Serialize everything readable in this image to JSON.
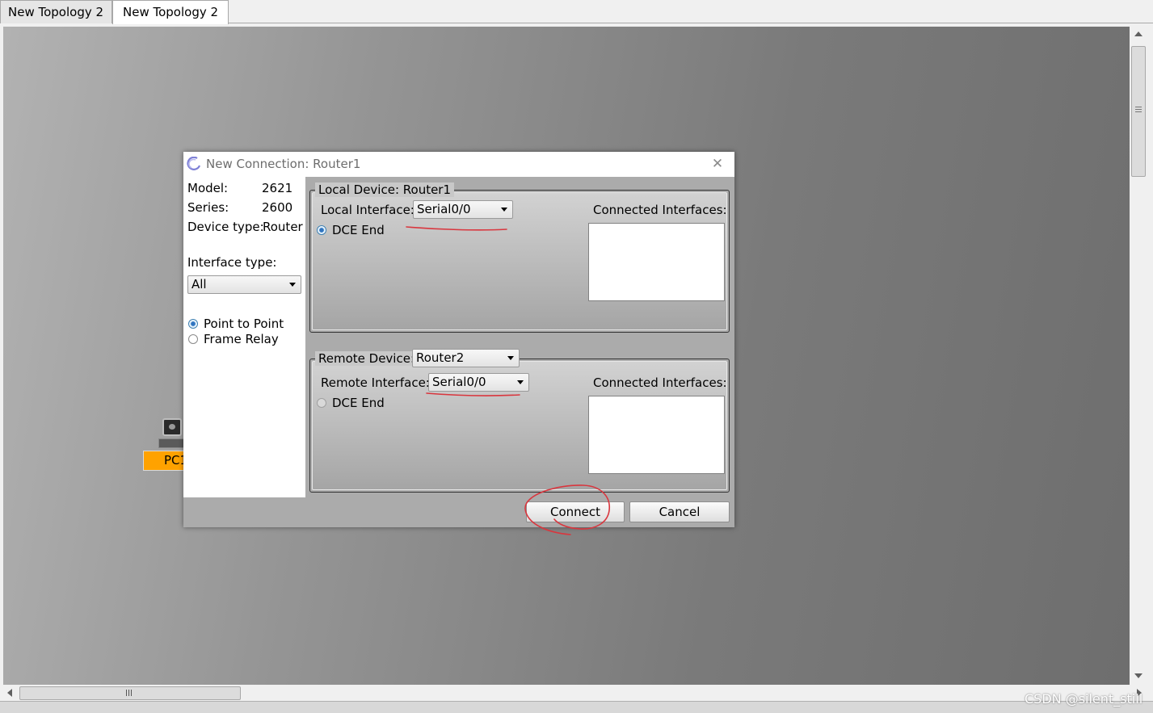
{
  "tabs": [
    {
      "label": "New Topology 2",
      "active": false
    },
    {
      "label": "New Topology 2",
      "active": true
    }
  ],
  "workspace": {
    "device_label": "PC1"
  },
  "dialog": {
    "title": "New Connection: Router1",
    "close_icon": "close-icon",
    "info": {
      "model_label": "Model:",
      "model_value": "2621",
      "series_label": "Series:",
      "series_value": "2600",
      "device_type_label": "Device type:",
      "device_type_value": "Router"
    },
    "interface_type": {
      "label": "Interface type:",
      "selected": "All"
    },
    "link_types": [
      {
        "label": "Point to Point",
        "checked": true
      },
      {
        "label": "Frame Relay",
        "checked": false
      }
    ],
    "local": {
      "legend": "Local Device: Router1",
      "interface_label": "Local Interface:",
      "interface_value": "Serial0/0",
      "dce_label": "DCE End",
      "dce_checked": true,
      "connected_label": "Connected Interfaces:"
    },
    "remote": {
      "device_label": "Remote Device:",
      "device_value": "Router2",
      "interface_label": "Remote Interface:",
      "interface_value": "Serial0/0",
      "dce_label": "DCE End",
      "dce_checked": false,
      "connected_label": "Connected Interfaces:"
    },
    "buttons": {
      "connect": "Connect",
      "cancel": "Cancel"
    }
  },
  "annotation_color": "#d9363e",
  "watermark": "CSDN @silent_still"
}
